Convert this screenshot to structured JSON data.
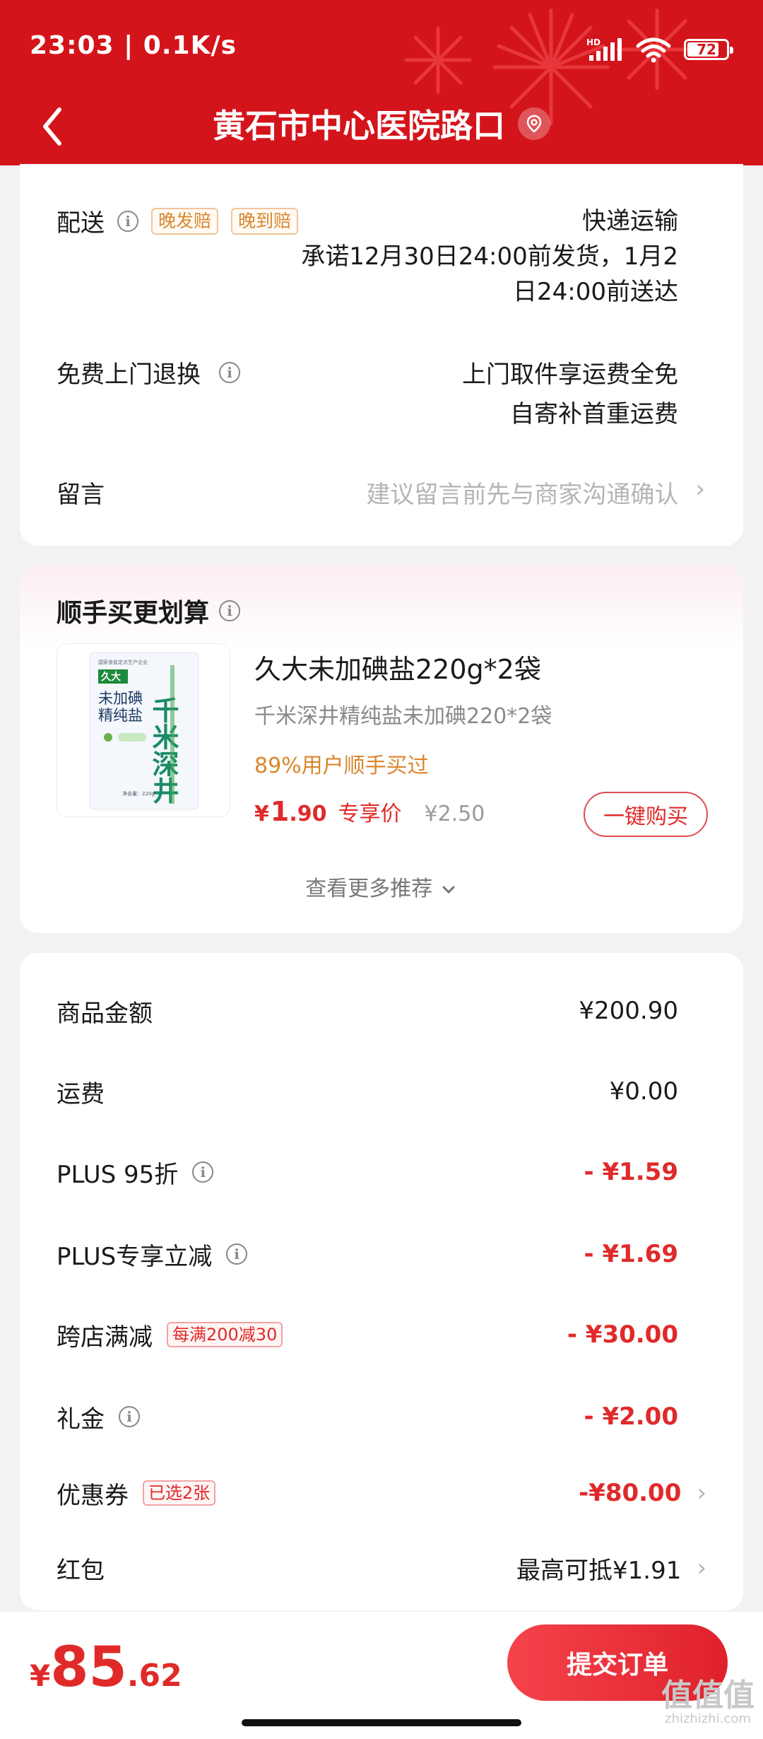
{
  "status_bar": {
    "time": "23:03 | 0.1K/s",
    "battery": "72"
  },
  "nav": {
    "title": "黄石市中心医院路口"
  },
  "delivery": {
    "label": "配送",
    "tags": [
      "晚发赔",
      "晚到赔"
    ],
    "method": "快递运输",
    "promise_line1": "承诺12月30日24:00前发货，1月2",
    "promise_line2": "日24:00前送达"
  },
  "returns": {
    "label": "免费上门退换",
    "line1": "上门取件享运费全免",
    "line2": "自寄补首重运费"
  },
  "message": {
    "label": "留言",
    "placeholder": "建议留言前先与商家沟通确认"
  },
  "recommend": {
    "title": "顺手买更划算",
    "product": {
      "name": "久大未加碘盐220g*2袋",
      "subtitle": "千米深井精纯盐未加碘220*2袋",
      "stat": "89%用户顺手买过",
      "price_symbol": "¥",
      "price_int": "1",
      "price_dec": ".90",
      "price_label": "专享价",
      "original_price": "¥2.50",
      "buy_label": "一键购买",
      "image_text": {
        "brand": "久大",
        "line1": "未加碘",
        "line2": "精纯盐",
        "slogan": "千米深井",
        "top": "国家食盐定点生产企业",
        "net": "净含量：220g"
      }
    },
    "see_more": "查看更多推荐"
  },
  "summary": {
    "rows": [
      {
        "label": "商品金额",
        "value": "¥200.90"
      },
      {
        "label": "运费",
        "value": "¥0.00"
      },
      {
        "label": "PLUS 95折",
        "value": "- ¥1.59"
      },
      {
        "label": "PLUS专享立减",
        "value": "- ¥1.69"
      },
      {
        "label": "跨店满减",
        "tag": "每满200减30",
        "value": "- ¥30.00"
      },
      {
        "label": "礼金",
        "value": "- ¥2.00"
      },
      {
        "label": "优惠券",
        "tag": "已选2张",
        "value": "-¥80.00"
      },
      {
        "label": "红包",
        "value": "最高可抵¥1.91"
      }
    ]
  },
  "bottom": {
    "total_symbol": "¥",
    "total_int": "85",
    "total_dec": ".62",
    "submit_label": "提交订单",
    "watermark": "值值值",
    "watermark_url": "zhizhizhi.com"
  },
  "colors": {
    "brand_red": "#d4141b",
    "price_red": "#e02a2a",
    "tag_orange": "#d9862d"
  }
}
